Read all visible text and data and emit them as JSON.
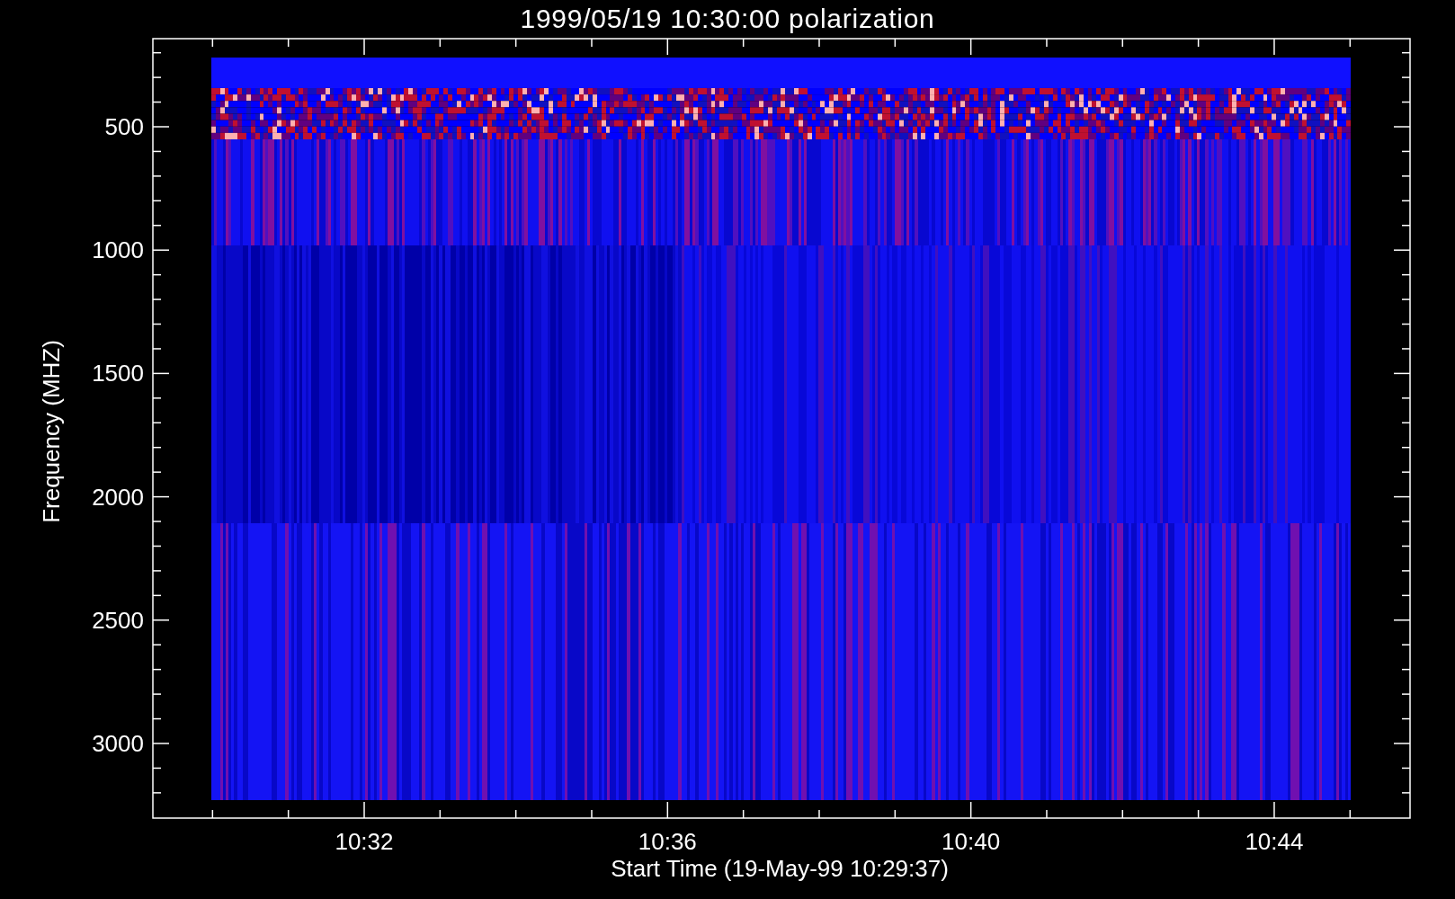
{
  "title": "1999/05/19 10:30:00 polarization",
  "y_axis": {
    "label": "Frequency (MHZ)",
    "ticks": [
      "500",
      "1000",
      "1500",
      "2000",
      "2500",
      "3000"
    ]
  },
  "x_axis": {
    "label": "Start Time (19-May-99 10:29:37)",
    "ticks": [
      "10:32",
      "10:36",
      "10:40",
      "10:44"
    ]
  }
}
